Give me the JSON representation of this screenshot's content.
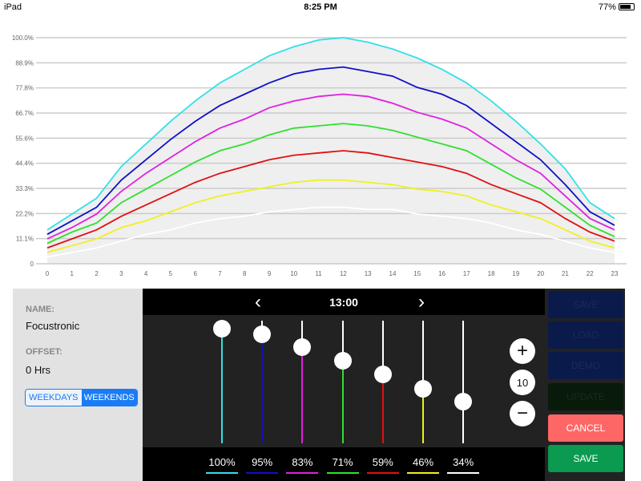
{
  "status_bar": {
    "device": "iPad",
    "time": "8:25 PM",
    "battery": "77%",
    "battery_level": 0.77
  },
  "chart_data": {
    "type": "line",
    "x": [
      0,
      1,
      2,
      3,
      4,
      5,
      6,
      7,
      8,
      9,
      10,
      11,
      12,
      13,
      14,
      15,
      16,
      17,
      18,
      19,
      20,
      21,
      22,
      23
    ],
    "y_ticks": [
      "0",
      "11.1%",
      "22.2%",
      "33.3%",
      "44.4%",
      "55.6%",
      "66.7%",
      "77.8%",
      "88.9%",
      "100.0%"
    ],
    "ylim": [
      0,
      100
    ],
    "grid": true,
    "fill_under_top_series": "#efefef",
    "series": [
      {
        "color": "#33e0e8",
        "values": [
          15,
          22,
          29,
          43,
          53,
          63,
          72,
          80,
          86,
          92,
          96,
          99,
          100,
          98,
          95,
          91,
          86,
          80,
          72,
          63,
          53,
          42,
          27,
          20
        ]
      },
      {
        "color": "#1010c8",
        "values": [
          13,
          19,
          25,
          37,
          46,
          55,
          63,
          70,
          75,
          80,
          84,
          86,
          87,
          85,
          83,
          78,
          75,
          70,
          62,
          54,
          46,
          35,
          23,
          17
        ]
      },
      {
        "color": "#e020e0",
        "values": [
          11,
          16,
          22,
          32,
          40,
          47,
          54,
          60,
          64,
          69,
          72,
          74,
          75,
          74,
          71,
          67,
          64,
          60,
          53,
          46,
          40,
          30,
          20,
          15
        ]
      },
      {
        "color": "#30e030",
        "values": [
          9,
          14,
          18,
          27,
          33,
          39,
          45,
          50,
          53,
          57,
          60,
          61,
          62,
          61,
          59,
          56,
          53,
          50,
          44,
          38,
          33,
          25,
          17,
          12
        ]
      },
      {
        "color": "#e01010",
        "values": [
          7,
          11,
          15,
          21,
          26,
          31,
          36,
          40,
          43,
          46,
          48,
          49,
          50,
          49,
          47,
          45,
          43,
          40,
          35,
          31,
          27,
          20,
          14,
          10
        ]
      },
      {
        "color": "#f0f020",
        "values": [
          5,
          8,
          11,
          16,
          19,
          23,
          27,
          30,
          32,
          34,
          36,
          37,
          37,
          36,
          35,
          33,
          32,
          30,
          26,
          23,
          20,
          15,
          10,
          7
        ]
      },
      {
        "color": "#ffffff",
        "values": [
          3,
          5,
          7,
          10,
          13,
          15,
          18,
          20,
          21,
          23,
          24,
          25,
          25,
          24,
          24,
          22,
          21,
          20,
          18,
          15,
          13,
          10,
          7,
          5
        ]
      }
    ]
  },
  "profile": {
    "name_label": "NAME:",
    "name": "Focustronic",
    "offset_label": "OFFSET:",
    "offset": "0 Hrs",
    "weekdays": "WEEKDAYS",
    "weekends": "WEEKENDS",
    "selected": "WEEKENDS"
  },
  "editor": {
    "time": "13:00",
    "prev": "‹",
    "next": "›",
    "step": "10",
    "plus": "+",
    "minus": "−",
    "channels": [
      {
        "value": 100,
        "label": "100%",
        "color": "#33e0e8"
      },
      {
        "value": 95,
        "label": "95%",
        "color": "#1010c8"
      },
      {
        "value": 83,
        "label": "83%",
        "color": "#e020e0"
      },
      {
        "value": 71,
        "label": "71%",
        "color": "#30e030"
      },
      {
        "value": 59,
        "label": "59%",
        "color": "#e01010"
      },
      {
        "value": 46,
        "label": "46%",
        "color": "#f0f020"
      },
      {
        "value": 34,
        "label": "34%",
        "color": "#ffffff"
      }
    ]
  },
  "buttons": {
    "save_top": "SAVE",
    "load": "LOAD",
    "demo": "DEMO",
    "update": "UPDATE",
    "cancel": "CANCEL",
    "save": "SAVE"
  }
}
